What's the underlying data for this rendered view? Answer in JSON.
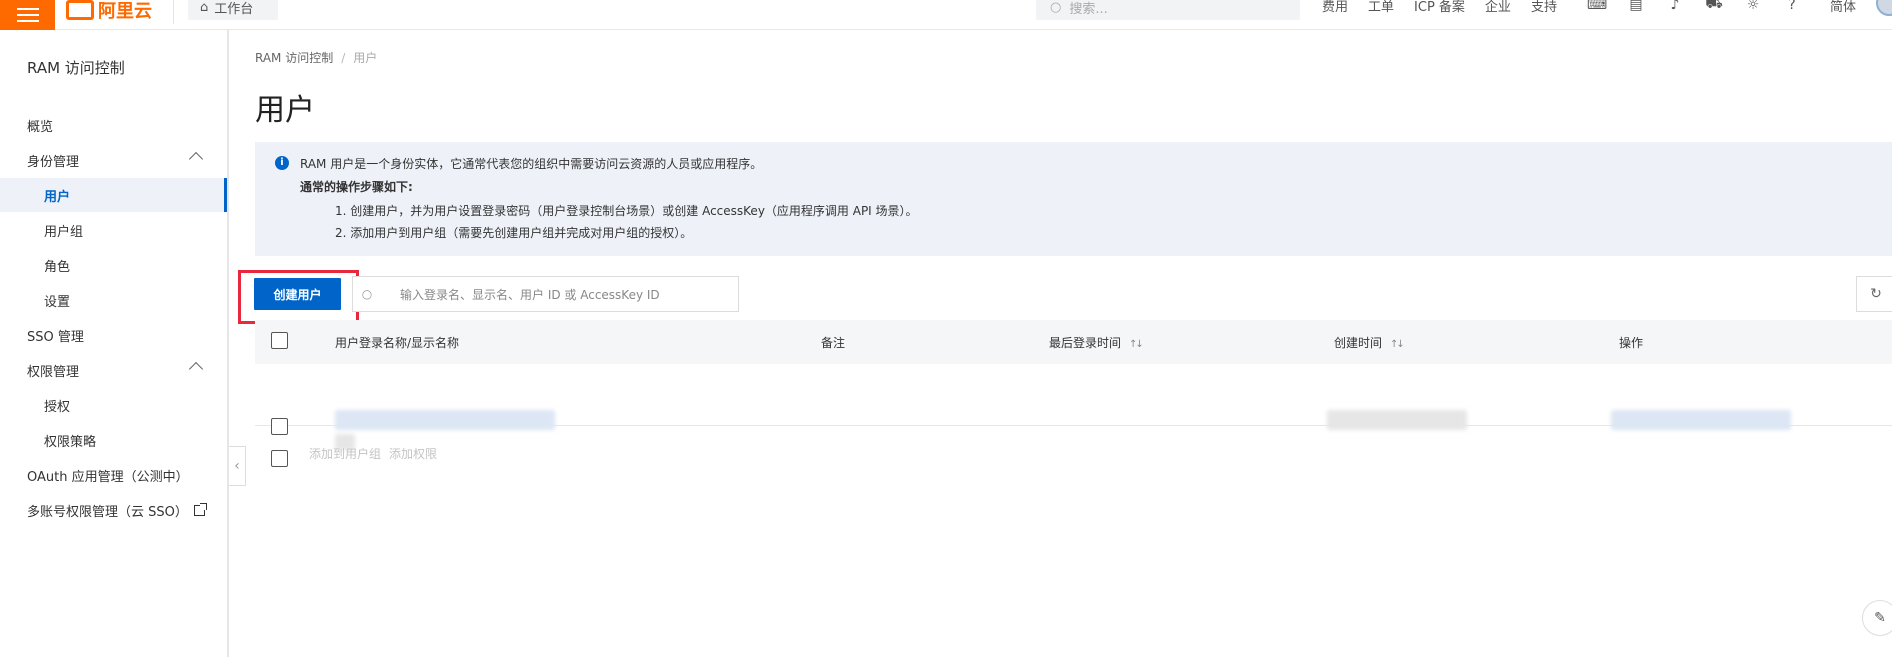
{
  "topbar": {
    "logo_text": "阿里云",
    "workbench_label": "工作台",
    "search_placeholder": "搜索...",
    "nav": [
      "费用",
      "工单",
      "ICP 备案",
      "企业",
      "支持"
    ],
    "icons": [
      "terminal-icon",
      "document-icon",
      "bell-icon",
      "cart-icon",
      "bulb-icon",
      "help-icon"
    ],
    "language": "简体"
  },
  "sidebar": {
    "title": "RAM 访问控制",
    "items": [
      {
        "label": "概览"
      },
      {
        "label": "身份管理"
      },
      {
        "label": "用户"
      },
      {
        "label": "用户组"
      },
      {
        "label": "角色"
      },
      {
        "label": "设置"
      },
      {
        "label": "SSO 管理"
      },
      {
        "label": "权限管理"
      },
      {
        "label": "授权"
      },
      {
        "label": "权限策略"
      },
      {
        "label": "OAuth 应用管理（公测中）"
      },
      {
        "label": "多账号权限管理（云 SSO）"
      }
    ]
  },
  "main": {
    "breadcrumb": [
      "RAM 访问控制",
      "用户"
    ],
    "title": "用户",
    "notice": {
      "line1": "RAM 用户是一个身份实体，它通常代表您的组织中需要访问云资源的人员或应用程序。",
      "line2": "通常的操作步骤如下:",
      "line3": "1. 创建用户，并为用户设置登录密码（用户登录控制台场景）或创建 AccessKey（应用程序调用 API 场景）。",
      "line4": "2. 添加用户到用户组（需要先创建用户组并完成对用户组的授权）。"
    },
    "create_button": "创建用户",
    "search_placeholder": "输入登录名、显示名、用户 ID 或 AccessKey ID",
    "table": {
      "columns": [
        "用户登录名称/显示名称",
        "备注",
        "最后登录时间",
        "创建时间",
        "操作"
      ]
    },
    "bulk_actions": [
      "添加到用户组",
      "添加权限"
    ]
  },
  "colors": {
    "brand": "#ff6a00",
    "primary": "#0064c8",
    "highlight_box": "#e8283c"
  }
}
